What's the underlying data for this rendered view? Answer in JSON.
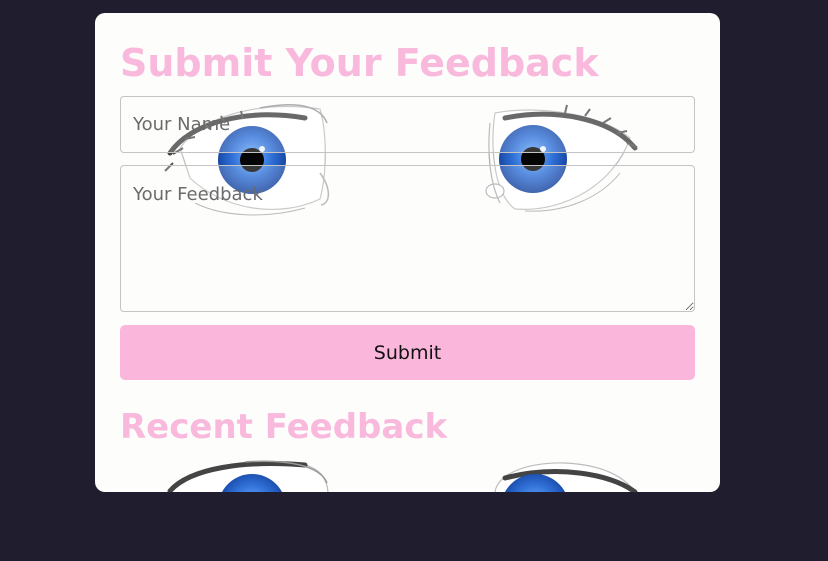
{
  "form": {
    "title": "Submit Your Feedback",
    "name_placeholder": "Your Name",
    "feedback_placeholder": "Your Feedback",
    "submit_label": "Submit"
  },
  "recent": {
    "title": "Recent Feedback"
  },
  "colors": {
    "page_background": "#1f1d2e",
    "card_background": "#fdfdfb",
    "accent_pink": "#f9b9dd",
    "button_pink": "#fbb7db",
    "iris_blue": "#2f6fd6"
  },
  "decorations": {
    "background_image": "anime-eyes-illustration"
  }
}
